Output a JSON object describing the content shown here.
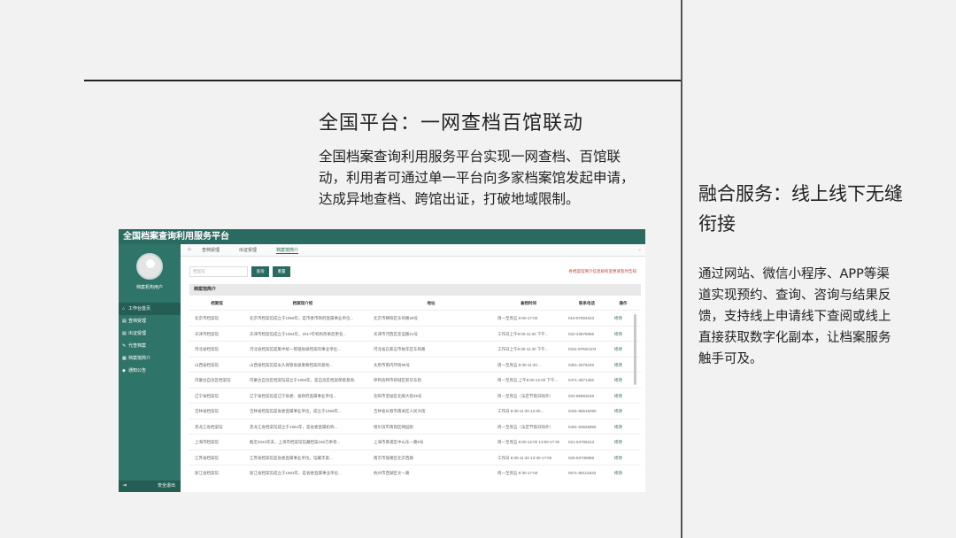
{
  "slide": {
    "headline": "全国平台：一网查档百馆联动",
    "intro": "全国档案查询利用服务平台实现一网查档、百馆联动，利用者可通过单一平台向多家档案馆发起申请，达成异地查档、跨馆出证，打破地域限制。",
    "right_title": "融合服务：线上线下无缝衔接",
    "right_text": "通过网站、微信小程序、APP等渠道实现预约、查询、咨询与结果反馈，支持线上申请线下查阅或线上直接获取数字化副本，让档案服务触手可及。"
  },
  "app": {
    "title": "全国档案查询利用服务平台",
    "user_label": "档案机构用户",
    "sidebar": [
      {
        "icon": "home-icon",
        "glyph": "⌂",
        "label": "工作台首页",
        "active": true
      },
      {
        "icon": "doc-icon",
        "glyph": "▤",
        "label": "查档受理",
        "active": false
      },
      {
        "icon": "doc-icon",
        "glyph": "▤",
        "label": "出证受理",
        "active": false
      },
      {
        "icon": "edit-icon",
        "glyph": "✎",
        "label": "代查档案",
        "active": false
      },
      {
        "icon": "archive-icon",
        "glyph": "▦",
        "label": "档案馆简介",
        "active": false
      },
      {
        "icon": "bell-icon",
        "glyph": "◆",
        "label": "通知公告",
        "active": false
      }
    ],
    "logout": "安全退出",
    "tabs": [
      "查档受理",
      "出证受理",
      "档案馆简介"
    ],
    "search_placeholder": "档案馆",
    "query_btn": "查询",
    "reset_btn": "重置",
    "notice": "各档案馆简介信息如有变更请及时告知",
    "section_title": "档案馆简介",
    "columns": [
      "档案馆",
      "档案馆介绍",
      "地址",
      "查档时间",
      "联系电话",
      "操作"
    ],
    "rows": [
      [
        "北京市档案馆",
        "北京市档案馆成立于1959年，是市委市政府直属事业单位...",
        "北京市朝阳区东坝路28号",
        "周一至周五 9:00-17:00",
        "010-87693323",
        "修改"
      ],
      [
        "天津市档案馆",
        "天津市档案馆成立于1964年，2017年机构改革后更名...",
        "天津市河西区友谊路21号",
        "工作日上午9:00-11:30 下午...",
        "022-23675955",
        "修改"
      ],
      [
        "河北省档案馆",
        "河北省档案馆是集中统一管理省级档案的事业单位...",
        "河北省石家庄市裕华区东岗路",
        "工作日上午8:30-11:30 下午...",
        "0311-87602103",
        "修改"
      ],
      [
        "山西省档案馆",
        "山西省档案馆是永久保管省级重要档案的基地...",
        "太原市南内环街98号",
        "周一至周五 8:30-11:30...",
        "0351-2575246",
        "修改"
      ],
      [
        "内蒙古自治区档案馆",
        "内蒙古自治区档案馆成立于1958年，是自治区档案保管基地...",
        "呼和浩特市新城区新华东街",
        "周一至周五 上午9:00-12:00 下午...",
        "0471-4871482",
        "修改"
      ],
      [
        "辽宁省档案馆",
        "辽宁省档案馆是辽宁省委、省政府直属事业单位...",
        "沈阳市皇姑区北陵大街45号",
        "周一至周五（法定节假日除外）",
        "024-86893248",
        "修改"
      ],
      [
        "吉林省档案馆",
        "吉林省档案馆是省委直属事业单位，成立于1959年...",
        "吉林省长春市南关区人民大街",
        "工作日 8:30-11:30 13:30...",
        "0431-85516050",
        "修改"
      ],
      [
        "黑龙江省档案馆",
        "黑龙江省档案馆成立于1964年，是省委直属机构...",
        "哈尔滨市南岗区颐园街",
        "周一至周五（法定节假日除外）",
        "0451-53626869",
        "修改"
      ],
      [
        "上海市档案馆",
        "截至2023年末，上海市档案馆馆藏档案155万余卷...",
        "上海市黄浦区中山东一路9号",
        "周一至周五 9:00-12:00 13:00-17:00",
        "021-63756313",
        "修改"
      ],
      [
        "江苏省档案馆",
        "江苏省档案馆是省委直属事业单位，馆藏丰富...",
        "南京市鼓楼区北京西路",
        "工作日 8:30-11:30 13:30-17:00",
        "025-83736858",
        "修改"
      ],
      [
        "浙江省档案馆",
        "浙江省档案馆成立于1963年，是省委直属事业单位...",
        "杭州市西湖区文一路",
        "周一至周五 8:30-17:00",
        "0571-85114533",
        "修改"
      ]
    ]
  },
  "colors": {
    "app_header": "#2b6a60",
    "sidebar": "#2f7468",
    "accent": "#2b6a60",
    "notice": "#c0392b"
  }
}
